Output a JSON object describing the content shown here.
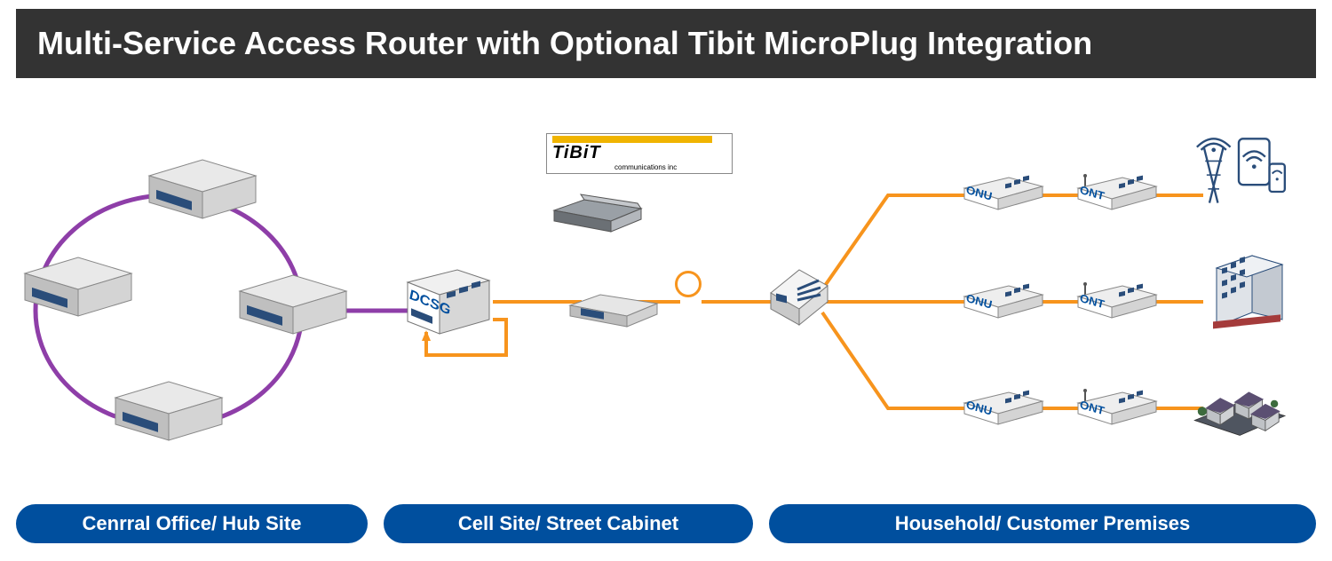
{
  "title": "Multi-Service Access Router with Optional Tibit MicroPlug Integration",
  "sections": {
    "central_office": "Cenrral Office/ Hub Site",
    "cell_site": "Cell Site/ Street Cabinet",
    "household": "Household/ Customer Premises"
  },
  "dcsg_label": "DCSG",
  "tibit": {
    "brand": "TiBiT",
    "sub": "communications inc"
  },
  "device_labels": {
    "onu": "ONU",
    "ont": "ONT"
  },
  "colors": {
    "ring_link": "#8e3ea8",
    "fiber_link": "#f7941d",
    "pill_bg": "#004f9e",
    "title_bg": "#333333"
  },
  "topology": {
    "hub_servers": 4,
    "premises_lines": 3,
    "endpoints": [
      "cell-tower-wifi",
      "building",
      "houses"
    ]
  }
}
